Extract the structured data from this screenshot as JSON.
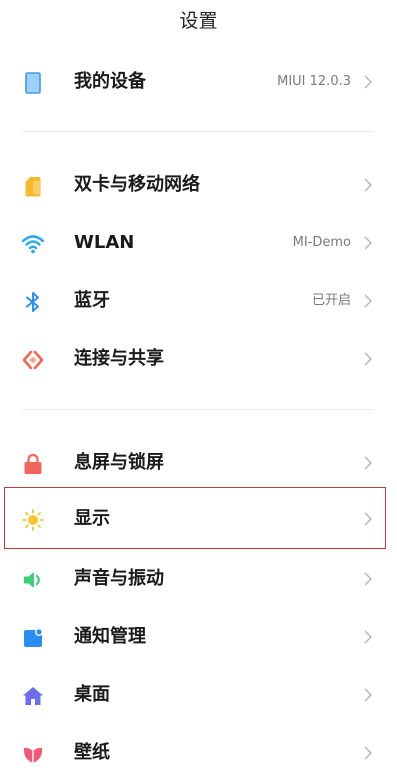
{
  "header": {
    "title": "设置"
  },
  "rows": [
    {
      "key": "device",
      "label": "我的设备",
      "value": "MIUI 12.0.3",
      "icon": "device-icon"
    },
    {
      "key": "sim",
      "label": "双卡与移动网络",
      "value": "",
      "icon": "sim-card-icon"
    },
    {
      "key": "wlan",
      "label": "WLAN",
      "value": "MI-Demo",
      "icon": "wifi-icon"
    },
    {
      "key": "bluetooth",
      "label": "蓝牙",
      "value": "已开启",
      "icon": "bluetooth-icon"
    },
    {
      "key": "share",
      "label": "连接与共享",
      "value": "",
      "icon": "connection-share-icon"
    },
    {
      "key": "lock",
      "label": "息屏与锁屏",
      "value": "",
      "icon": "lock-icon"
    },
    {
      "key": "display",
      "label": "显示",
      "value": "",
      "icon": "sun-icon"
    },
    {
      "key": "sound",
      "label": "声音与振动",
      "value": "",
      "icon": "speaker-icon"
    },
    {
      "key": "notify",
      "label": "通知管理",
      "value": "",
      "icon": "notification-icon"
    },
    {
      "key": "desktop",
      "label": "桌面",
      "value": "",
      "icon": "home-icon"
    },
    {
      "key": "wallpaper",
      "label": "壁纸",
      "value": "",
      "icon": "wallpaper-flower-icon"
    }
  ],
  "colors": {
    "device": "#3b9cf0",
    "sim": "#f5b82e",
    "wifi": "#22a8f0",
    "bluetooth": "#2f8ef2",
    "share": "#f06a4b",
    "lock": "#f0665b",
    "sun": "#f7c531",
    "sound": "#3fcf7b",
    "notify": "#2b8df0",
    "home": "#6c6ef0",
    "wallpaper": "#ef5a76",
    "highlight": "#c0393b"
  }
}
